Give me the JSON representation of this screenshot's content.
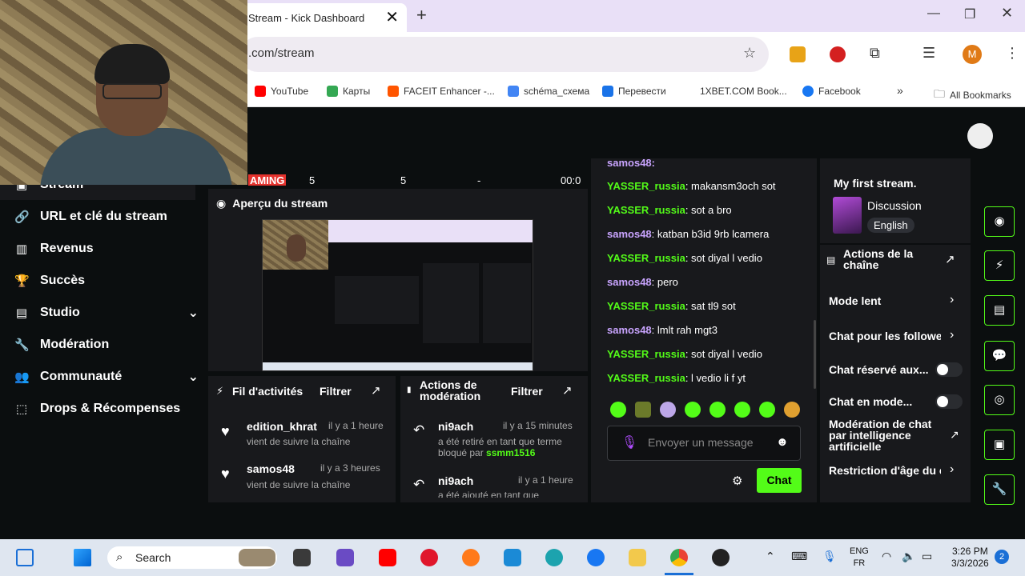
{
  "browser": {
    "tab_title": "Stream - Kick Dashboard",
    "tab_close": "✕",
    "new_tab": "+",
    "url": ".com/stream",
    "profile_initial": "M",
    "bookmarks": [
      "YouTube",
      "Карты",
      "FACEIT Enhancer -...",
      "schéma_схема",
      "Перевести",
      "1XBET.COM Book...",
      "Facebook"
    ],
    "more": "»",
    "all_bookmarks": "All Bookmarks"
  },
  "stats": [
    "AMING",
    "5",
    "5",
    "-",
    "00:0"
  ],
  "sidebar": {
    "items": [
      {
        "label": "Stream",
        "icon": "stream-icon"
      },
      {
        "label": "URL et clé du stream",
        "icon": "link-icon"
      },
      {
        "label": "Revenus",
        "icon": "chart-icon"
      },
      {
        "label": "Succès",
        "icon": "trophy-icon"
      },
      {
        "label": "Studio",
        "icon": "studio-icon",
        "chevron": "⌄"
      },
      {
        "label": "Modération",
        "icon": "wrench-icon"
      },
      {
        "label": "Communauté",
        "icon": "community-icon",
        "chevron": "⌄"
      },
      {
        "label": "Drops & Récompenses",
        "icon": "drops-icon"
      }
    ]
  },
  "preview": {
    "title": "Aperçu du stream"
  },
  "activity": {
    "title": "Fil d'activités",
    "filter": "Filtrer",
    "items": [
      {
        "user": "edition_khrat",
        "time": "il y a 1 heure",
        "text": "vient de suivre la chaîne"
      },
      {
        "user": "samos48",
        "time": "il y a 3 heures",
        "text": "vient de suivre la chaîne"
      }
    ]
  },
  "modactions": {
    "title_line1": "Actions de",
    "title_line2": "modération",
    "filter": "Filtrer",
    "items": [
      {
        "user": "ni9ach",
        "time": "il y a 15 minutes",
        "text": "a été retiré en tant que terme bloqué par ",
        "by": "ssmm1516"
      },
      {
        "user": "ni9ach",
        "time": "il y a 1 heure",
        "text": "a été ajouté en tant que"
      }
    ]
  },
  "chat": {
    "top_user": "samos48:",
    "messages": [
      {
        "user": "YASSER_russia",
        "text": "makansm3och sot",
        "color": "green"
      },
      {
        "user": "YASSER_russia",
        "text": "sot a bro",
        "color": "green"
      },
      {
        "user": "samos48",
        "text": "katban b3id 9rb lcamera",
        "color": "purple"
      },
      {
        "user": "YASSER_russia",
        "text": "sot diyal l vedio",
        "color": "green"
      },
      {
        "user": "samos48",
        "text": "pero",
        "color": "purple"
      },
      {
        "user": "YASSER_russia",
        "text": "sat tl9 sot",
        "color": "green"
      },
      {
        "user": "samos48",
        "text": "lmlt rah mgt3",
        "color": "purple"
      },
      {
        "user": "YASSER_russia",
        "text": "sot diyal l vedio",
        "color": "green"
      },
      {
        "user": "YASSER_russia",
        "text": "l vedio li f yt",
        "color": "green"
      }
    ],
    "placeholder": "Envoyer un message",
    "send": "Chat"
  },
  "stream_info": {
    "title": "My first stream.",
    "category": "Discussion",
    "language": "English"
  },
  "channel_actions": {
    "title_line1": "Actions de la",
    "title_line2": "chaîne",
    "items": [
      {
        "label": "Mode lent",
        "control": "chevron"
      },
      {
        "label": "Chat pour les followe",
        "control": "chevron"
      },
      {
        "label": "Chat réservé aux...",
        "control": "toggle"
      },
      {
        "label": "Chat en mode...",
        "control": "toggle"
      },
      {
        "label": "Modération de chat par intelligence artificielle",
        "control": "external"
      },
      {
        "label": "Restriction d'âge du c",
        "control": "chevron"
      }
    ]
  },
  "taskbar": {
    "search": "Search",
    "lang_line1": "ENG",
    "lang_line2": "FR",
    "time": "3:26 PM",
    "date": "3/3/2026",
    "badge": "2"
  },
  "colors": {
    "accent": "#53fc18",
    "panel": "#18191c",
    "background": "#0b0e0f",
    "purple_user": "#c9a4ff"
  }
}
